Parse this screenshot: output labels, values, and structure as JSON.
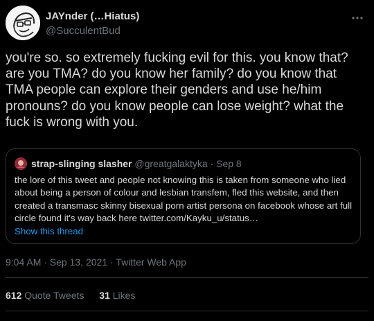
{
  "author": {
    "display_name": "JAYnder (…Hiatus)",
    "handle": "@SucculentBud",
    "avatar_icon": "doodle-face-avatar"
  },
  "more_icon": "more-horizontal-icon",
  "tweet_text": "you're so. so extremely fucking evil for this. you know that? are you TMA? do you know her family? do you know that TMA people can explore their genders and use he/him pronouns? do you know people can lose weight? what the fuck is wrong with you.",
  "quoted": {
    "display_name": "strap-slinging slasher",
    "handle": "@greatgalaktyka",
    "separator": "·",
    "date": "Sep 8",
    "text": "the lore of this tweet and people not knowing this is taken from someone who lied about being a person of colour and lesbian transfem, fled this website, and then created a transmasc skinny bisexual porn artist persona on facebook whose art full circle found it's way back here twitter.com/Kayku_u/status…",
    "show_thread_label": "Show this thread"
  },
  "timestamp": "9:04 AM · Sep 13, 2021 · Twitter Web App",
  "stats": {
    "quote_tweets_count": "612",
    "quote_tweets_label": "Quote Tweets",
    "likes_count": "31",
    "likes_label": "Likes"
  },
  "colors": {
    "background": "#000000",
    "text": "#d9d9d9",
    "muted": "#6e767d",
    "link": "#1d9bf0",
    "border": "#2f3336"
  }
}
